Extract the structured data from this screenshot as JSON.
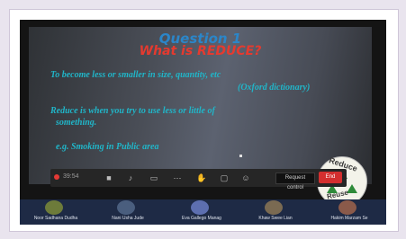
{
  "slide": {
    "title_line1": "Question 1",
    "title_line2": "What is REDUCE?",
    "definition": "To become less or smaller in size, quantity, etc",
    "source": "(Oxford dictionary)",
    "explanation_line1": "Reduce is when you try to use less or little of",
    "explanation_line2": "something.",
    "example": "e.g. Smoking in Public area"
  },
  "logo": {
    "top": "Reduce",
    "bottom": "Reuse"
  },
  "toolbar": {
    "timer": "39:54",
    "remote_label": "Request control",
    "end_label": "End"
  },
  "participants": [
    {
      "name": "Noor Sadhana Dudha"
    },
    {
      "name": "Nani Usha Jude"
    },
    {
      "name": "Eva Gallego Manag"
    },
    {
      "name": "Khaw Swee Lian"
    },
    {
      "name": "Hakim Marzam Se"
    }
  ],
  "colors": {
    "title_blue": "#2b86c9",
    "title_red": "#e53a2f",
    "body_cyan": "#20b6c9",
    "end_red": "#d32f2f"
  }
}
